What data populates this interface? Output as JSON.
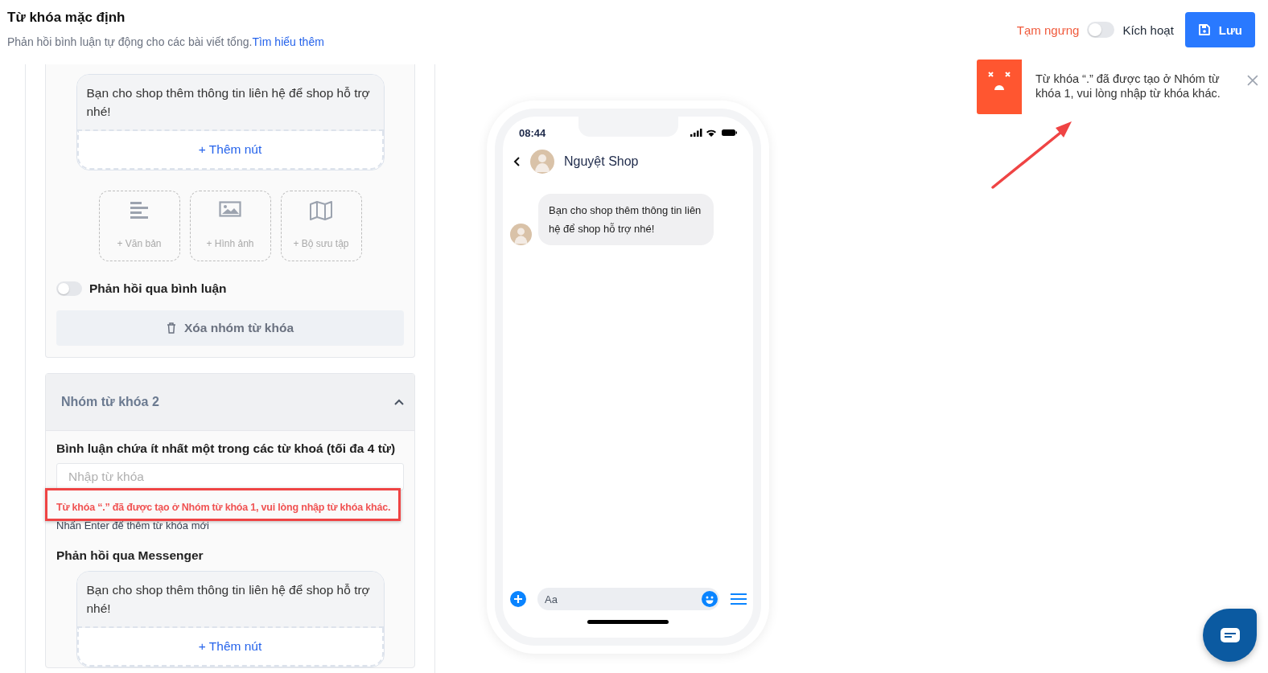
{
  "header": {
    "title": "Từ khóa mặc định",
    "subtitle": "Phản hồi bình luận tự động cho các bài viết tổng.",
    "link": "Tìm hiểu thêm"
  },
  "status_toggle": {
    "off_label": "Tạm ngưng",
    "on_label": "Kích hoạt",
    "on": false
  },
  "save_button": {
    "label": "Lưu"
  },
  "keyword_group_1": {
    "message": "Bạn cho shop thêm thông tin liên hệ để shop hỗ trợ nhé!",
    "add_button": "+ Thêm nút",
    "attachments": [
      {
        "kind": "text",
        "label": "+ Văn bản"
      },
      {
        "kind": "image",
        "label": "+ Hình ảnh"
      },
      {
        "kind": "gallery",
        "label": "+ Bộ sưu tập"
      }
    ],
    "comment_reply": {
      "label": "Phản hồi qua bình luận",
      "on": false
    },
    "delete_button": "Xóa nhóm từ khóa"
  },
  "keyword_group_2": {
    "title": "Nhóm từ khóa 2",
    "expanded": true,
    "keywords_label": "Bình luận chứa ít nhất một trong các từ khoá (tối đa 4 từ)",
    "keyword_input": {
      "placeholder": "Nhập từ khóa"
    },
    "error": "Từ khóa “.” đã được tạo ở Nhóm từ khóa 1, vui lòng nhập từ khóa khác.",
    "hint": "Nhấn Enter để thêm từ khóa mới",
    "messenger_label": "Phản hồi qua Messenger",
    "message": "Bạn cho shop thêm thông tin liên hệ để shop hỗ trợ nhé!",
    "add_button": "+ Thêm nút"
  },
  "preview": {
    "time": "08:44",
    "shop_name": "Nguyệt Shop",
    "message": "Bạn cho shop thêm thông tin liên hệ để shop hỗ trợ nhé!",
    "composer_placeholder": "Aa"
  },
  "toast": {
    "message": "Từ khóa “.” đã được tạo ở Nhóm từ khóa 1, vui lòng nhập từ khóa khác."
  }
}
